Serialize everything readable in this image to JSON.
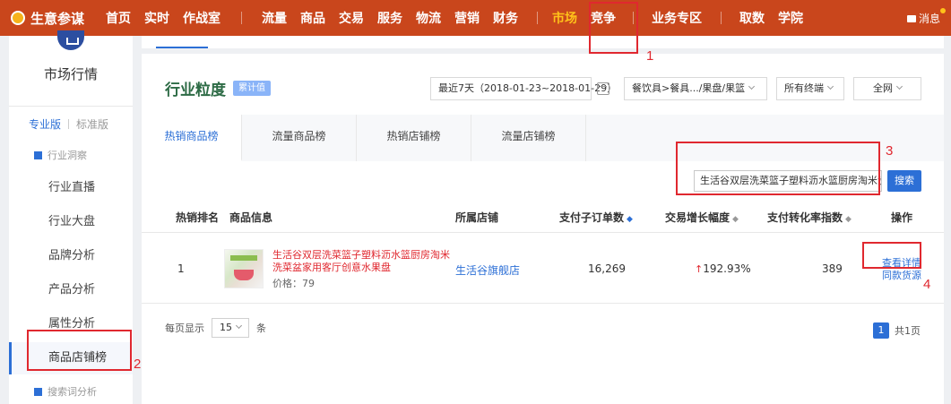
{
  "brand": {
    "name": "生意参谋",
    "logo_icon": "brand-logo-icon"
  },
  "nav": {
    "items": [
      "首页",
      "实时",
      "作战室",
      "流量",
      "商品",
      "交易",
      "服务",
      "物流",
      "营销",
      "财务",
      "市场",
      "竞争",
      "业务专区",
      "取数",
      "学院"
    ],
    "active": "市场",
    "message_label": "消息"
  },
  "sidebar": {
    "title": "市场行情",
    "tab_pro": "专业版",
    "tab_std": "标准版",
    "group_insight": "行业洞察",
    "items": [
      "行业直播",
      "行业大盘",
      "品牌分析",
      "产品分析",
      "属性分析",
      "商品店铺榜"
    ],
    "active_item": "商品店铺榜",
    "group_search": "搜索词分析"
  },
  "panel": {
    "title": "行业粒度",
    "badge": "累计值",
    "date_range": "最近7天（2018-01-23~2018-01-29）",
    "category": "餐饮具>餐具.../果盘/果篮",
    "terminal": "所有终端",
    "network": "全网"
  },
  "tabs": [
    "热销商品榜",
    "流量商品榜",
    "热销店铺榜",
    "流量店铺榜"
  ],
  "active_tab": "热销商品榜",
  "search": {
    "value": "生活谷双层洗菜篮子塑料沥水篮厨房淘米洗",
    "button": "搜索"
  },
  "table": {
    "headers": {
      "rank": "热销排名",
      "product": "商品信息",
      "shop": "所属店铺",
      "orders": "支付子订单数",
      "growth": "交易增长幅度",
      "conversion": "支付转化率指数",
      "action": "操作"
    },
    "rows": [
      {
        "rank": "1",
        "title": "生活谷双层洗菜篮子塑料沥水篮厨房淘米洗菜盆家用客厅创意水果盘",
        "price": "价格：79",
        "shop": "生活谷旗舰店",
        "orders": "16,269",
        "growth": "192.93%",
        "conversion": "389",
        "action_detail": "查看详情",
        "action_source": "同款货源"
      }
    ]
  },
  "pager": {
    "prefix": "每页显示",
    "size": "15",
    "suffix": "条",
    "current": "1",
    "total": "共1页"
  },
  "annotations": [
    "1",
    "2",
    "3",
    "4"
  ],
  "colors": {
    "nav_bg": "#c9461c",
    "accent": "#2c6fd6",
    "annotation": "#e0282f",
    "active_nav": "#ffc21a"
  }
}
